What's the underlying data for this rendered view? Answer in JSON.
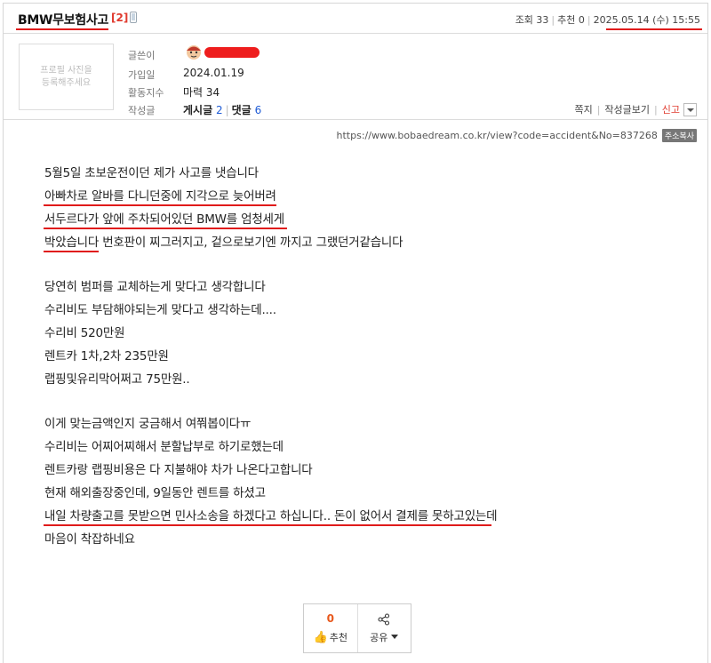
{
  "post": {
    "title": "BMW무보험사고",
    "comment_count": "[2]",
    "views_label": "조회 33",
    "recommend_label": "추천 0",
    "date": "2025.05.14 (수) 15:55"
  },
  "profile": {
    "photo_placeholder_line1": "프로필 사진을",
    "photo_placeholder_line2": "등록해주세요",
    "author_label": "글쓴이",
    "joined_label": "가입일",
    "joined_value": "2024.01.19",
    "activity_label": "활동지수",
    "activity_value": "마력 34",
    "posts_label": "작성글",
    "posts_text": "게시글",
    "posts_count": "2",
    "comments_text": "댓글",
    "comments_count": "6"
  },
  "tools": {
    "message": "쪽지",
    "view_posts": "작성글보기",
    "report": "신고"
  },
  "url": {
    "text": "https://www.bobaedream.co.kr/view?code=accident&No=837268",
    "copy_label": "주소복사"
  },
  "body": {
    "lines": [
      "5월5일 초보운전이던 제가 사고를 냇습니다",
      "아빠차로 알바를 다니던중에 지각으로 늦어버려",
      "서두르다가 앞에 주차되어있던 BMW를 엄청세게",
      "박았습니다 번호판이 찌그러지고, 겉으로보기엔 까지고 그랬던거같습니다",
      "당연히 범퍼를 교체하는게 맞다고 생각합니다",
      "수리비도 부담해야되는게 맞다고 생각하는데....",
      "수리비 520만원",
      "렌트카 1차,2차 235만원",
      "랩핑및유리막어쩌고 75만원..",
      "이게 맞는금액인지 궁금해서 여쭤봅이다ㅠ",
      "수리비는 어찌어찌해서 분할납부로 하기로했는데",
      "렌트카랑 랩핑비용은 다 지불해야 차가 나온다고합니다",
      "현재 해외출장중인데, 9일동안 렌트를 하셨고",
      "내일 차량출고를 못받으면 민사소송을 하겠다고 하십니다.. 돈이 없어서 결제를 못하고있는데",
      "마음이 착잡하네요"
    ]
  },
  "actions": {
    "recommend_count": "0",
    "recommend_label": "추천",
    "share_label": "공유"
  },
  "colors": {
    "accent_red": "#e01b1b",
    "link_blue": "#1e5bd6",
    "recommend_orange": "#e8581c"
  }
}
